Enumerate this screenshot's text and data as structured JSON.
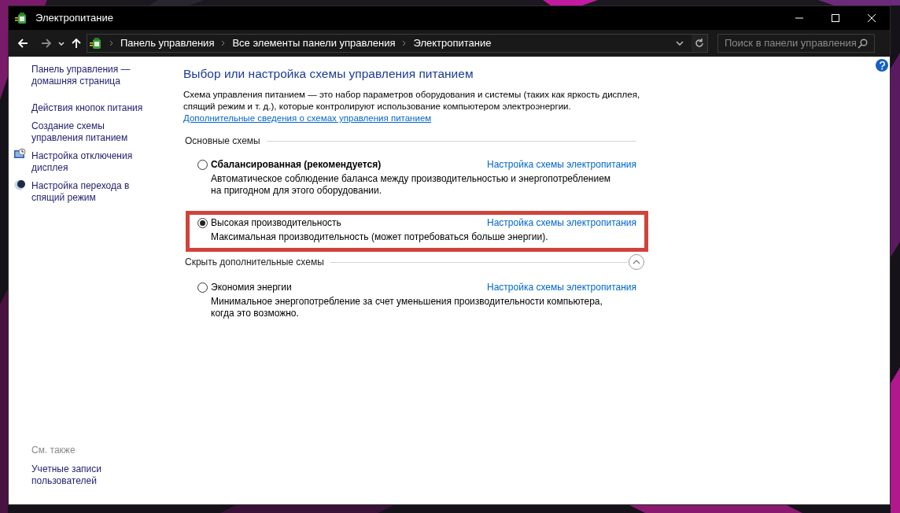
{
  "window": {
    "title": "Электропитание"
  },
  "nav": {
    "path": [
      "Панель управления",
      "Все элементы панели управления",
      "Электропитание"
    ],
    "search": {
      "placeholder": "Поиск в панели управления"
    }
  },
  "sidebar": {
    "items": [
      {
        "label": "Панель управления — домашняя страница"
      },
      {
        "label": "Действия кнопок питания"
      },
      {
        "label": "Создание схемы управления питанием"
      },
      {
        "label": "Настройка отключения дисплея"
      },
      {
        "label": "Настройка перехода в спящий режим"
      }
    ],
    "see_also": {
      "heading": "См. также",
      "items": [
        "Учетные записи пользователей"
      ]
    }
  },
  "main": {
    "heading": "Выбор или настройка схемы управления питанием",
    "intro": "Схема управления питанием — это набор параметров оборудования и системы (таких как яркость дисплея, спящий режим и т. д.), которые контролируют использование компьютером электроэнергии.",
    "more_link": "Дополнительные сведения о схемах управления питанием",
    "groups": [
      {
        "heading": "Основные схемы",
        "toggle": false,
        "schemes": [
          {
            "name": "Сбалансированная (рекомендуется)",
            "emphasized": true,
            "selected": false,
            "highlighted": false,
            "link": "Настройка схемы электропитания",
            "description": "Автоматическое соблюдение баланса между производительностью и энергопотреблением на пригодном для этого оборудовании."
          },
          {
            "name": "Высокая производительность",
            "emphasized": false,
            "selected": true,
            "highlighted": true,
            "link": "Настройка схемы электропитания",
            "description": "Максимальная производительность (может потребоваться больше энергии)."
          }
        ]
      },
      {
        "heading": "Скрыть дополнительные схемы",
        "toggle": true,
        "schemes": [
          {
            "name": "Экономия энергии",
            "emphasized": false,
            "selected": false,
            "highlighted": false,
            "link": "Настройка схемы электропитания",
            "description": "Минимальное энергопотребление за счет уменьшения производительности компьютера, когда это возможно."
          }
        ]
      }
    ]
  }
}
